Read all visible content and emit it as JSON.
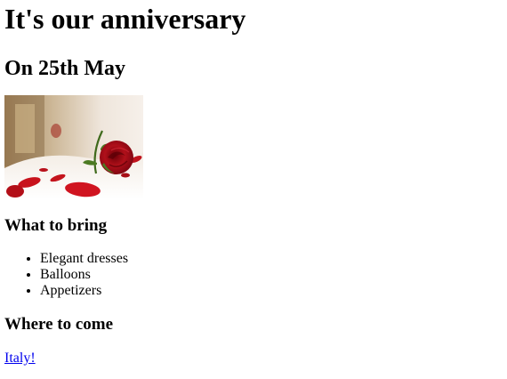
{
  "heading": {
    "title": "It's our anniversary",
    "date": "On 25th May"
  },
  "image": {
    "subject": "red rose on bed with rose petals"
  },
  "bring": {
    "heading": "What to bring",
    "items": [
      "Elegant dresses",
      "Balloons",
      "Appetizers"
    ]
  },
  "location": {
    "heading": "Where to come",
    "link_text": "Italy!"
  },
  "colors": {
    "link": "#0000ee",
    "rose": "#b0101a"
  }
}
